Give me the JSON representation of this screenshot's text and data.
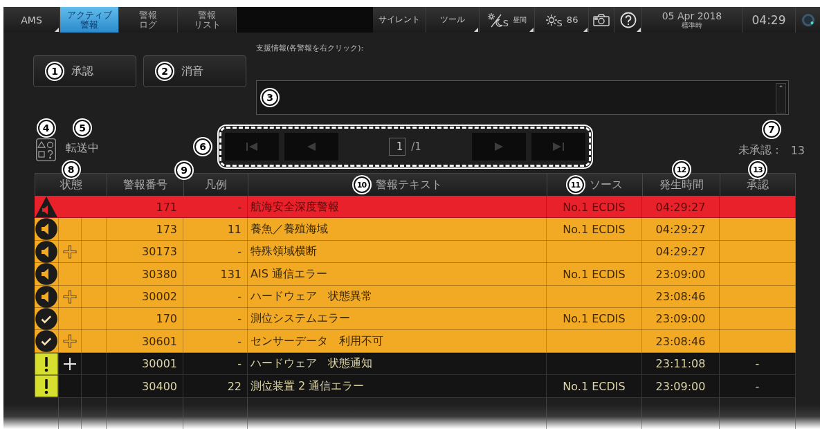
{
  "top_bar": {
    "app_menu": {
      "label": "AMS",
      "menu": true
    },
    "tabs": [
      {
        "lines": [
          "アクティブ",
          "警報"
        ],
        "selected": true
      },
      {
        "lines": [
          "警報",
          "ログ"
        ],
        "selected": false
      },
      {
        "lines": [
          "警報",
          "リスト"
        ],
        "selected": false
      }
    ],
    "tools": [
      {
        "kind": "text",
        "label": "サイレント",
        "menu": false
      },
      {
        "kind": "text",
        "label": "ツール",
        "menu": true
      },
      {
        "kind": "daynight",
        "subscript": "S",
        "label": "昼間",
        "menu": true
      },
      {
        "kind": "brightness",
        "subscript": "S",
        "label": "86",
        "menu": true
      },
      {
        "kind": "camera",
        "menu": false
      },
      {
        "kind": "help",
        "menu": true
      }
    ],
    "date": "05 Apr 2018",
    "time_zone": "標準時",
    "clock": "04:29"
  },
  "actions": [
    {
      "callout": "1",
      "label": "承認"
    },
    {
      "callout": "2",
      "label": "消音"
    }
  ],
  "support_info": {
    "callout": "3",
    "label": "支援情報(各警報を右クリック):"
  },
  "transfer": {
    "icon_callout": "4",
    "callout": "5",
    "label": "転送中"
  },
  "pager": {
    "callout": "6",
    "page": "1",
    "total": "/1",
    "buttons": [
      {
        "kind": "first",
        "disabled": true
      },
      {
        "kind": "previous",
        "disabled": true
      },
      {
        "kind": "next",
        "disabled": true
      },
      {
        "kind": "last",
        "disabled": true
      }
    ]
  },
  "unacknowledged": {
    "callout": "7",
    "label": "未承認：",
    "count": "13"
  },
  "table": {
    "columns": [
      {
        "label": "状態",
        "callout": "8"
      },
      {
        "label": "警報番号",
        "callout": "9"
      },
      {
        "label": "凡例"
      },
      {
        "label": "警報テキスト",
        "callout": "10"
      },
      {
        "label": "ソース",
        "callout": "11"
      },
      {
        "label": "発生時間",
        "callout": "12"
      },
      {
        "label": "承認",
        "callout": "13"
      }
    ],
    "rows": [
      {
        "kind": "alarm",
        "acknowledged": false,
        "plus_mark": false,
        "number": "171",
        "legend": "-",
        "text": "航海安全深度警報",
        "source": "No.1 ECDIS",
        "time": "04:29:27"
      },
      {
        "kind": "warning",
        "acknowledged": false,
        "plus_mark": false,
        "number": "173",
        "legend": "11",
        "text": "養魚／養殖海域",
        "source": "No.1 ECDIS",
        "time": "04:29:27"
      },
      {
        "kind": "warning",
        "acknowledged": false,
        "plus_mark": true,
        "number": "30173",
        "legend": "-",
        "text": "特殊領域横断",
        "time": "04:29:27"
      },
      {
        "kind": "warning",
        "acknowledged": false,
        "plus_mark": false,
        "number": "30380",
        "legend": "131",
        "text": "AIS 通信エラー",
        "source": "No.1 ECDIS",
        "time": "23:09:00"
      },
      {
        "kind": "warning",
        "acknowledged": false,
        "plus_mark": true,
        "number": "30002",
        "legend": "-",
        "text": "ハードウェア　状態異常",
        "time": "23:08:46"
      },
      {
        "kind": "warning",
        "acknowledged": true,
        "plus_mark": false,
        "number": "170",
        "legend": "-",
        "text": "測位システムエラー",
        "source": "No.1 ECDIS",
        "time": "23:09:00"
      },
      {
        "kind": "warning",
        "acknowledged": true,
        "plus_mark": true,
        "number": "30601",
        "legend": "-",
        "text": "センサーデータ　利用不可",
        "time": "23:08:46"
      },
      {
        "kind": "caution",
        "acknowledged": false,
        "plus_mark": true,
        "number": "30001",
        "legend": "-",
        "text": "ハードウェア　状態通知",
        "time": "23:11:08",
        "ack": "-"
      },
      {
        "kind": "caution",
        "acknowledged": false,
        "plus_mark": false,
        "number": "30400",
        "legend": "22",
        "text": "測位装置 2 通信エラー",
        "source": "No.1 ECDIS",
        "time": "23:09:00",
        "ack": "-"
      }
    ]
  }
}
